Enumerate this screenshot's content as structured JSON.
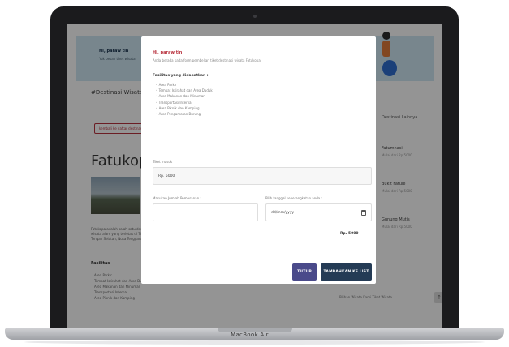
{
  "device": {
    "label": "MacBook Air"
  },
  "background": {
    "banner_title": "Hi, paraw tin",
    "banner_text": "Yuk pesan tiket wisata",
    "subtitle": "#Destinasi Wisata",
    "pill_label": "kembali ke daftar destinasi",
    "heading": "Fatukopa",
    "paragraph": "Fatukopa adalah salah satu destinasi wisata alam yang terletak di Timor Tengah Selatan, Nusa Tenggara Timur.",
    "facilities_title": "Fasilitas",
    "facilities": [
      "Area Parkir",
      "Tempat Istirahat dan Area Duduk",
      "Area Makanan dan Minuman",
      "Transportasi Internal",
      "Area Piknik dan Kamping"
    ],
    "side_title": "Destinasi Lainnya",
    "side_items": [
      {
        "title": "Fatumnasi",
        "price": "Mulai dari Rp 5000"
      },
      {
        "title": "Bukit Fatule",
        "price": "Mulai dari Rp 5000"
      },
      {
        "title": "Gunung Mutis",
        "price": "Mulai dari Rp 5000"
      }
    ],
    "footer_text": "Pilihan Wisata Kami  Tiket Wisata",
    "top_button": "↑"
  },
  "modal": {
    "title": "Hi, paraw tin",
    "subtitle": "Anda berada pada form pembelian tiket destinasi wisata Fatukopa",
    "facilities_title": "Fasilitas yang didapatkan :",
    "facilities": [
      "Area Parkir",
      "Tempat Istirahat dan Area Duduk",
      "Area Makanan dan Minuman",
      "Transportasi Internal",
      "Area Piknik dan Kamping",
      "Area Pengamatan Burung"
    ],
    "price_label": "Tiket masuk",
    "price_value": "Rp. 5000",
    "quantity_label": "Masukan Jumlah Pemesanan :",
    "quantity_value": "",
    "date_label": "Pilih tanggal keberangkatan anda :",
    "date_value": "dd/mm/yyyy",
    "total": "Rp. 5000",
    "close_button": "TUTUP",
    "add_to_cart_button": "TAMBAHKAN KE LIST"
  }
}
